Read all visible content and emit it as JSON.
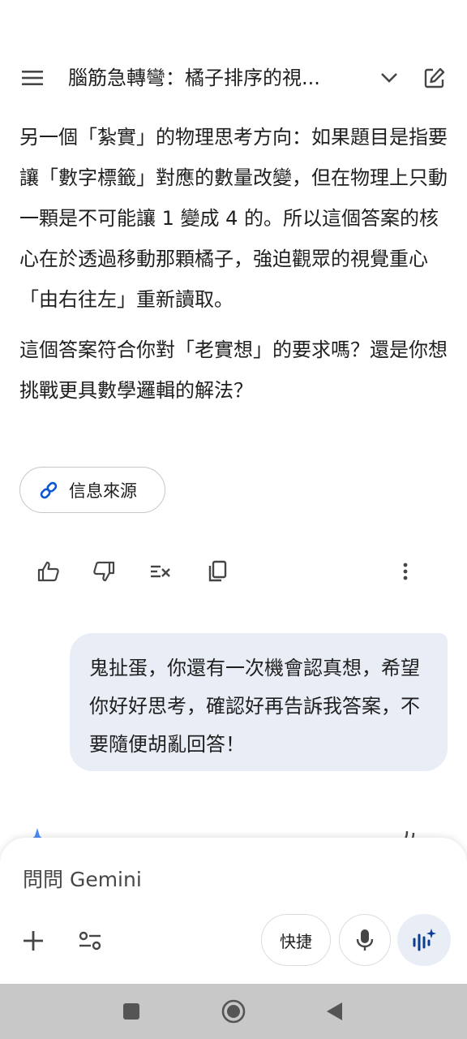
{
  "header": {
    "title": "腦筋急轉彎：橘子排序的視..."
  },
  "response": {
    "paragraph1": "另一個「紮實」的物理思考方向：如果題目是指要讓「數字標籤」對應的數量改變，但在物理上只動一顆是不可能讓 1 變成 4 的。所以這個答案的核心在於透過移動那顆橘子，強迫觀眾的視覺重心「由右往左」重新讀取。",
    "paragraph2": "這個答案符合你對「老實想」的要求嗎？還是你想挑戰更具數學邏輯的解法？",
    "sources_label": "信息來源"
  },
  "user_message": {
    "text": "鬼扯蛋，你還有一次機會認真想，希望你好好思考，確認好再告訴我答案，不要隨便胡亂回答！"
  },
  "composer": {
    "placeholder": "問問 Gemini",
    "quick_label": "快捷"
  },
  "icons": {
    "menu": "menu-icon",
    "chevron": "chevron-down-icon",
    "edit": "edit-icon",
    "link": "link-icon",
    "thumb_up": "thumb-up-icon",
    "thumb_down": "thumb-down-icon",
    "modify": "modify-response-icon",
    "copy": "copy-icon",
    "more": "more-vert-icon",
    "plus": "plus-icon",
    "tools": "tools-icon",
    "mic": "mic-icon",
    "live": "live-icon"
  },
  "colors": {
    "accent": "#0b57d0",
    "user_bubble": "#e9eef6",
    "nav_bar": "#c8c8c8"
  }
}
